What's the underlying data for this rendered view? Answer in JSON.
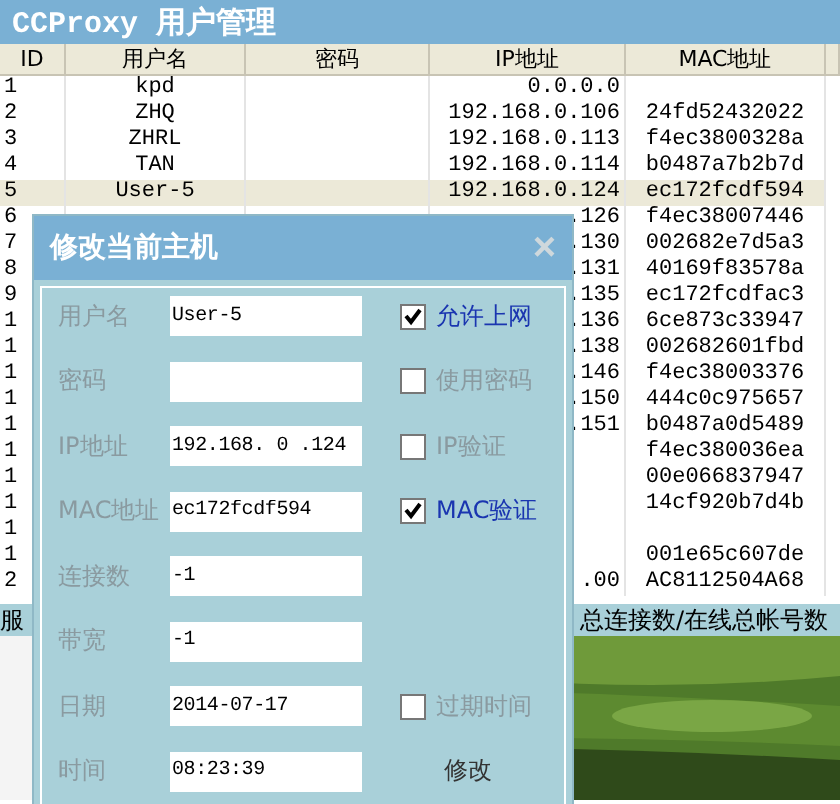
{
  "window": {
    "title": "CCProxy 用户管理"
  },
  "table": {
    "columns": [
      "ID",
      "用户名",
      "密码",
      "IP地址",
      "MAC地址"
    ],
    "rows": [
      {
        "cells": [
          "1",
          "kpd",
          "",
          "0.0.0.0",
          ""
        ],
        "selected": false
      },
      {
        "cells": [
          "2",
          "ZHQ",
          "",
          "192.168.0.106",
          "24fd52432022"
        ],
        "selected": false
      },
      {
        "cells": [
          "3",
          "ZHRL",
          "",
          "192.168.0.113",
          "f4ec3800328a"
        ],
        "selected": false
      },
      {
        "cells": [
          "4",
          "TAN",
          "",
          "192.168.0.114",
          "b0487a7b2b7d"
        ],
        "selected": false
      },
      {
        "cells": [
          "5",
          "User-5",
          "",
          "192.168.0.124",
          "ec172fcdf594"
        ],
        "selected": true
      },
      {
        "cells": [
          "6",
          "",
          "",
          ".126",
          "f4ec38007446"
        ],
        "selected": false
      },
      {
        "cells": [
          "7",
          "",
          "",
          ".130",
          "002682e7d5a3"
        ],
        "selected": false
      },
      {
        "cells": [
          "8",
          "",
          "",
          ".131",
          "40169f83578a"
        ],
        "selected": false
      },
      {
        "cells": [
          "9",
          "",
          "",
          ".135",
          "ec172fcdfac3"
        ],
        "selected": false
      },
      {
        "cells": [
          "1",
          "",
          "",
          ".136",
          "6ce873c33947"
        ],
        "selected": false
      },
      {
        "cells": [
          "1",
          "",
          "",
          ".138",
          "002682601fbd"
        ],
        "selected": false
      },
      {
        "cells": [
          "1",
          "",
          "",
          ".146",
          "f4ec38003376"
        ],
        "selected": false
      },
      {
        "cells": [
          "1",
          "",
          "",
          ".150",
          "444c0c975657"
        ],
        "selected": false
      },
      {
        "cells": [
          "1",
          "",
          "",
          ".151",
          "b0487a0d5489"
        ],
        "selected": false
      },
      {
        "cells": [
          "1",
          "",
          "",
          "",
          "f4ec380036ea"
        ],
        "selected": false
      },
      {
        "cells": [
          "1",
          "",
          "",
          "",
          "00e066837947"
        ],
        "selected": false
      },
      {
        "cells": [
          "1",
          "",
          "",
          "",
          "14cf920b7d4b"
        ],
        "selected": false
      },
      {
        "cells": [
          "1",
          "",
          "",
          "",
          ""
        ],
        "selected": false
      },
      {
        "cells": [
          "1",
          "",
          "",
          "",
          "001e65c607de"
        ],
        "selected": false
      },
      {
        "cells": [
          "2",
          "",
          "",
          ".00",
          "AC8112504A68"
        ],
        "selected": false
      }
    ]
  },
  "status_bar": {
    "left": "服",
    "right": "总连接数/在线总帐号数"
  },
  "dialog": {
    "title": "修改当前主机",
    "close": "×",
    "fields": [
      {
        "label": "用户名",
        "value": "User-5",
        "check": {
          "label": "允许上网",
          "checked": true
        }
      },
      {
        "label": "密码",
        "check": {
          "label": "使用密码",
          "checked": false
        }
      },
      {
        "label": "IP地址",
        "value": "192.168. 0 .124",
        "check": {
          "label": "IP验证",
          "checked": false
        }
      },
      {
        "label": "MAC地址",
        "value": "ec172fcdf594",
        "check": {
          "label": "MAC验证",
          "checked": true
        }
      },
      {
        "label": "连接数",
        "value": "-1"
      },
      {
        "label": "带宽",
        "value": "-1"
      },
      {
        "label": "日期",
        "value": "2014-07-17",
        "check": {
          "label": "过期时间",
          "checked": false
        }
      },
      {
        "label": "时间",
        "value": "08:23:39",
        "button": "修改"
      }
    ]
  }
}
